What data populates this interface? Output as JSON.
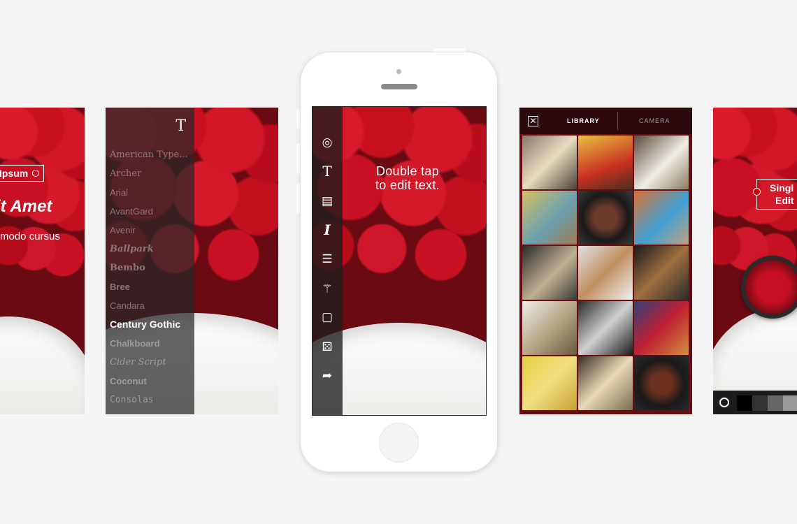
{
  "screen1": {
    "tag_text": "Ipsum",
    "title_text": "it Amet",
    "body_text": "modo cursus"
  },
  "screen2": {
    "fonts": [
      "American Type...",
      "Archer",
      "Arial",
      "AvantGard",
      "Avenir",
      "Ballpark",
      "Bembo",
      "Bree",
      "Candara",
      "Century Gothic",
      "Chalkboard",
      "Cider Script",
      "Coconut",
      "Consolas"
    ],
    "selected_font": "Century Gothic"
  },
  "screen3": {
    "prompt_line1": "Double tap",
    "prompt_line2": "to edit text."
  },
  "screen4": {
    "tabs": [
      "LIBRARY",
      "CAMERA"
    ],
    "active_tab": "LIBRARY",
    "close_glyph": "✕"
  },
  "screen5": {
    "tag_line1": "Singl",
    "tag_line2": "Edit"
  },
  "colors": {
    "raspberry": "#c8101f",
    "toolbar": "#1e1e1e",
    "library_header": "#2c0a0e"
  }
}
